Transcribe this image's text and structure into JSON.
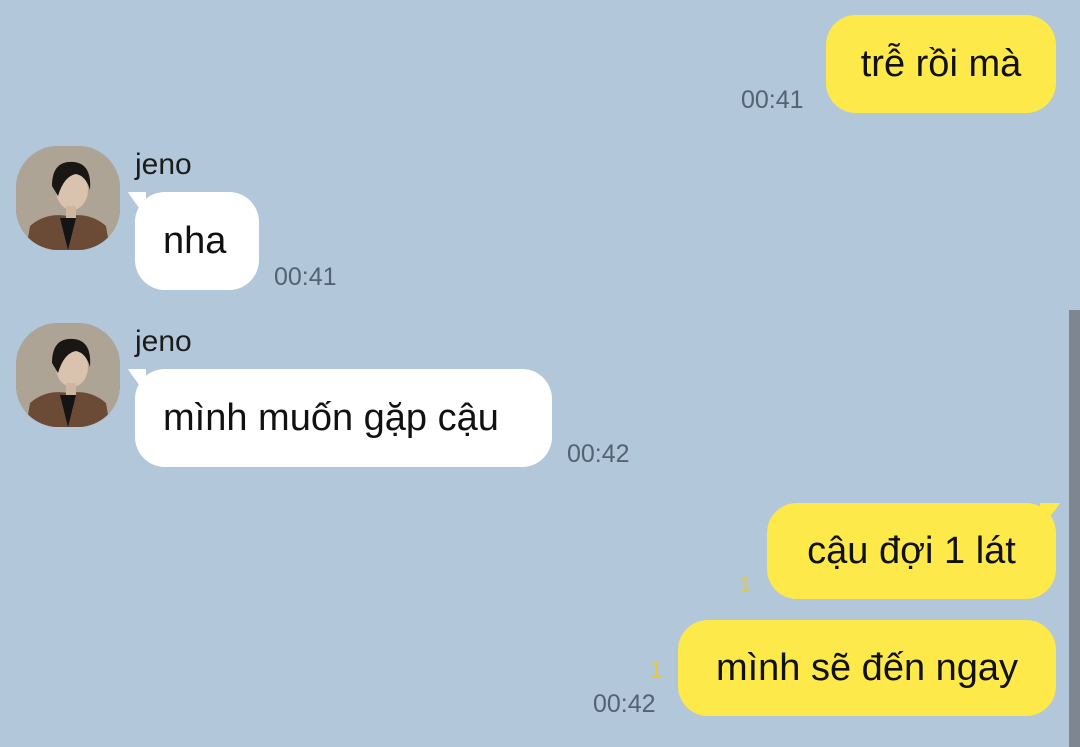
{
  "messages": [
    {
      "direction": "outgoing",
      "text": "trễ rồi mà",
      "time": "00:41",
      "unread": ""
    },
    {
      "direction": "incoming",
      "sender": "jeno",
      "text": "nha",
      "time": "00:41"
    },
    {
      "direction": "incoming",
      "sender": "jeno",
      "text": "mình muốn gặp cậu",
      "time": "00:42"
    },
    {
      "direction": "outgoing",
      "text": "cậu đợi 1 lát",
      "time": "",
      "unread": "1"
    },
    {
      "direction": "outgoing",
      "text": "mình sẽ đến ngay",
      "time": "00:42",
      "unread": "1"
    }
  ],
  "colors": {
    "background": "#b2c7da",
    "outgoing_bubble": "#fee94a",
    "incoming_bubble": "#ffffff",
    "unread_count": "#e0c93d",
    "timestamp": "#556273"
  }
}
